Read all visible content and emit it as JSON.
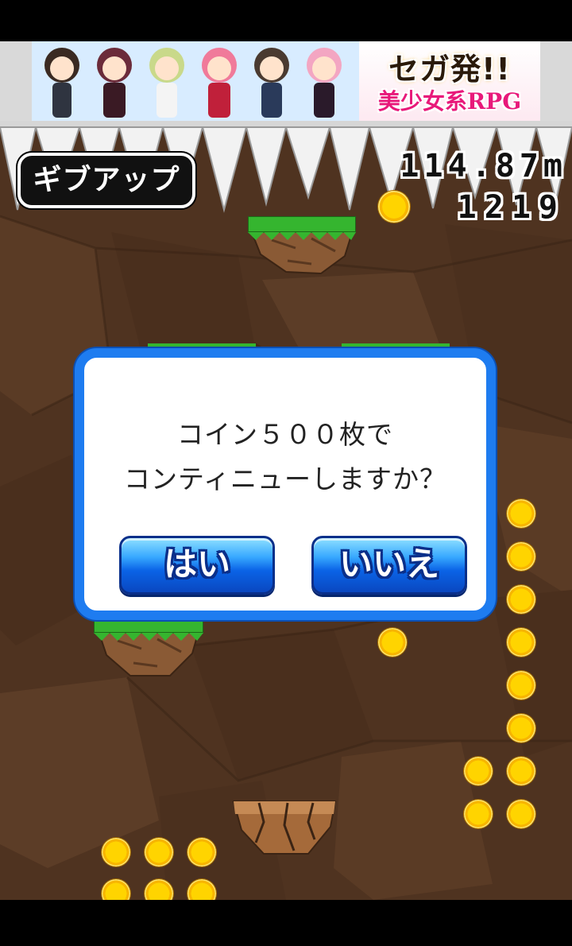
{
  "ad": {
    "title": "セガ発!!",
    "subtitle": "美少女系RPG"
  },
  "hud": {
    "giveup_label": "ギブアップ",
    "distance": "114.87m",
    "coins": "1219"
  },
  "dialog": {
    "line1": "コイン５００枚で",
    "line2": "コンティニューしますか？",
    "yes_label": "はい",
    "no_label": "いいえ"
  },
  "colors": {
    "cave": "#4f3320",
    "dialog_border": "#1e7cf0",
    "button_blue": "#0a63e6",
    "coin": "#ffd400",
    "grass": "#35b52f"
  }
}
